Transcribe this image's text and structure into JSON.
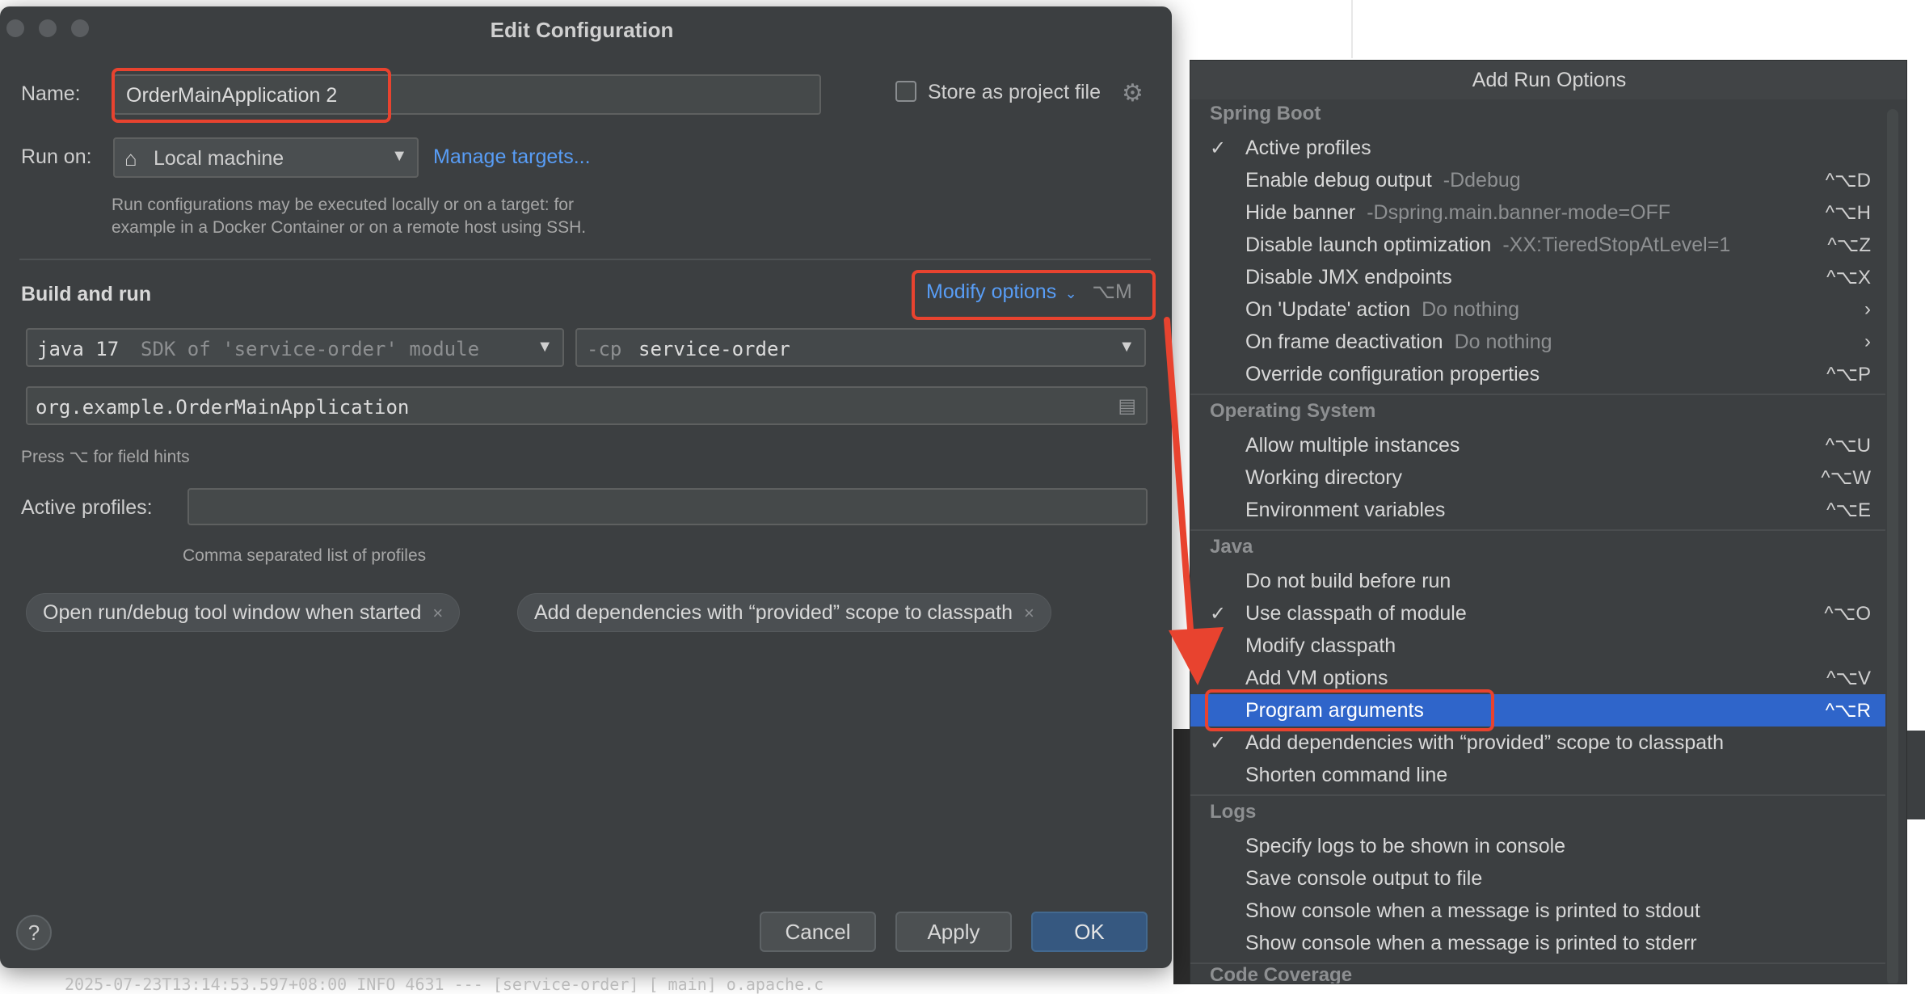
{
  "background": {
    "log_line": "2025-07-23T13:14:53.597+08:00  INFO 4631 --- [service-order] [           main] o.apache.c"
  },
  "dialog": {
    "title": "Edit Configuration",
    "name_label": "Name:",
    "name_value": "OrderMainApplication 2",
    "store_as_project_label": "Store as project file",
    "run_on_label": "Run on:",
    "run_on_value": "Local machine",
    "manage_targets_label": "Manage targets...",
    "run_on_hint_line1": "Run configurations may be executed locally or on a target: for",
    "run_on_hint_line2": "example in a Docker Container or on a remote host using SSH.",
    "section_title": "Build and run",
    "modify_options_label": "Modify options",
    "modify_options_shortcut": "⌥M",
    "sdk_name": "java 17",
    "sdk_desc": "SDK of 'service-order' module",
    "cp_prefix": "-cp",
    "cp_value": "service-order",
    "main_class": "org.example.OrderMainApplication",
    "field_hints": "Press ⌥ for field hints",
    "active_profiles_label": "Active profiles:",
    "active_profiles_value": "",
    "active_profiles_hint": "Comma separated list of profiles",
    "chips": [
      "Open run/debug tool window when started",
      "Add dependencies with “provided” scope to classpath"
    ],
    "chip_close": "×",
    "help_label": "?",
    "cancel_label": "Cancel",
    "apply_label": "Apply",
    "ok_label": "OK"
  },
  "popup": {
    "title": "Add Run Options",
    "groups": {
      "spring_boot": "Spring Boot",
      "operating_system": "Operating System",
      "java": "Java",
      "logs": "Logs",
      "code_coverage": "Code Coverage"
    },
    "items": [
      {
        "checked": "✓",
        "label": "Active profiles",
        "option": "",
        "shortcut": ""
      },
      {
        "checked": "",
        "label": "Enable debug output",
        "option": "-Ddebug",
        "shortcut": "^⌥D"
      },
      {
        "checked": "",
        "label": "Hide banner",
        "option": "-Dspring.main.banner-mode=OFF",
        "shortcut": "^⌥H"
      },
      {
        "checked": "",
        "label": "Disable launch optimization",
        "option": "-XX:TieredStopAtLevel=1",
        "shortcut": "^⌥Z"
      },
      {
        "checked": "",
        "label": "Disable JMX endpoints",
        "option": "",
        "shortcut": "^⌥X"
      },
      {
        "checked": "",
        "label": "On 'Update' action",
        "option": "Do nothing",
        "shortcut": "›"
      },
      {
        "checked": "",
        "label": "On frame deactivation",
        "option": "Do nothing",
        "shortcut": "›"
      },
      {
        "checked": "",
        "label": "Override configuration properties",
        "option": "",
        "shortcut": "^⌥P"
      },
      {
        "checked": "",
        "label": "Allow multiple instances",
        "option": "",
        "shortcut": "^⌥U"
      },
      {
        "checked": "",
        "label": "Working directory",
        "option": "",
        "shortcut": "^⌥W"
      },
      {
        "checked": "",
        "label": "Environment variables",
        "option": "",
        "shortcut": "^⌥E"
      },
      {
        "checked": "",
        "label": "Do not build before run",
        "option": "",
        "shortcut": ""
      },
      {
        "checked": "✓",
        "label": "Use classpath of module",
        "option": "",
        "shortcut": "^⌥O"
      },
      {
        "checked": "",
        "label": "Modify classpath",
        "option": "",
        "shortcut": ""
      },
      {
        "checked": "",
        "label": "Add VM options",
        "option": "",
        "shortcut": "^⌥V"
      },
      {
        "checked": "",
        "label": "Program arguments",
        "option": "",
        "shortcut": "^⌥R",
        "selected": true
      },
      {
        "checked": "✓",
        "label": "Add dependencies with “provided” scope to classpath",
        "option": "",
        "shortcut": ""
      },
      {
        "checked": "",
        "label": "Shorten command line",
        "option": "",
        "shortcut": ""
      },
      {
        "checked": "",
        "label": "Specify logs to be shown in console",
        "option": "",
        "shortcut": ""
      },
      {
        "checked": "",
        "label": "Save console output to file",
        "option": "",
        "shortcut": ""
      },
      {
        "checked": "",
        "label": "Show console when a message is printed to stdout",
        "option": "",
        "shortcut": ""
      },
      {
        "checked": "",
        "label": "Show console when a message is printed to stderr",
        "option": "",
        "shortcut": ""
      }
    ]
  },
  "colors": {
    "dialog_bg": "#3c3f41",
    "link_blue": "#589df6",
    "selection_blue": "#2f65ca",
    "annotation_red": "#e8432f",
    "ok_button": "#365880"
  }
}
